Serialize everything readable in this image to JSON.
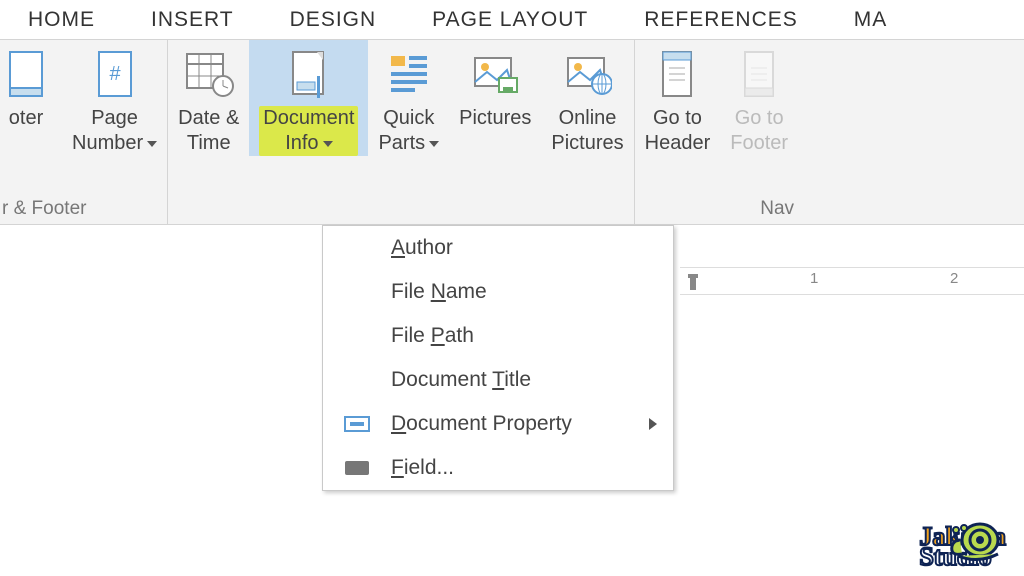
{
  "tabs": {
    "home": "HOME",
    "insert": "INSERT",
    "design": "DESIGN",
    "page_layout": "PAGE LAYOUT",
    "references": "REFERENCES",
    "last": "MA"
  },
  "ribbon": {
    "footer_label": "oter",
    "page_number_label": "Page\nNumber",
    "group_hf_label": "r & Footer",
    "date_time_label": "Date &\nTime",
    "doc_info_label": "Document\nInfo",
    "quick_parts_label": "Quick\nParts",
    "pictures_label": "Pictures",
    "online_pictures_label": "Online\nPictures",
    "goto_header_label": "Go to\nHeader",
    "goto_footer_label": "Go to\nFooter",
    "nav_label": "Nav"
  },
  "dropdown": {
    "author": "uthor",
    "file_name": "ame",
    "file_path": "ath",
    "doc_title": "itle",
    "doc_property": "ocument Property",
    "field": "ield..."
  },
  "watermark": {
    "line1": "Jakarta",
    "line2": "Studio"
  },
  "ruler": {
    "n1": "1",
    "n2": "2"
  }
}
